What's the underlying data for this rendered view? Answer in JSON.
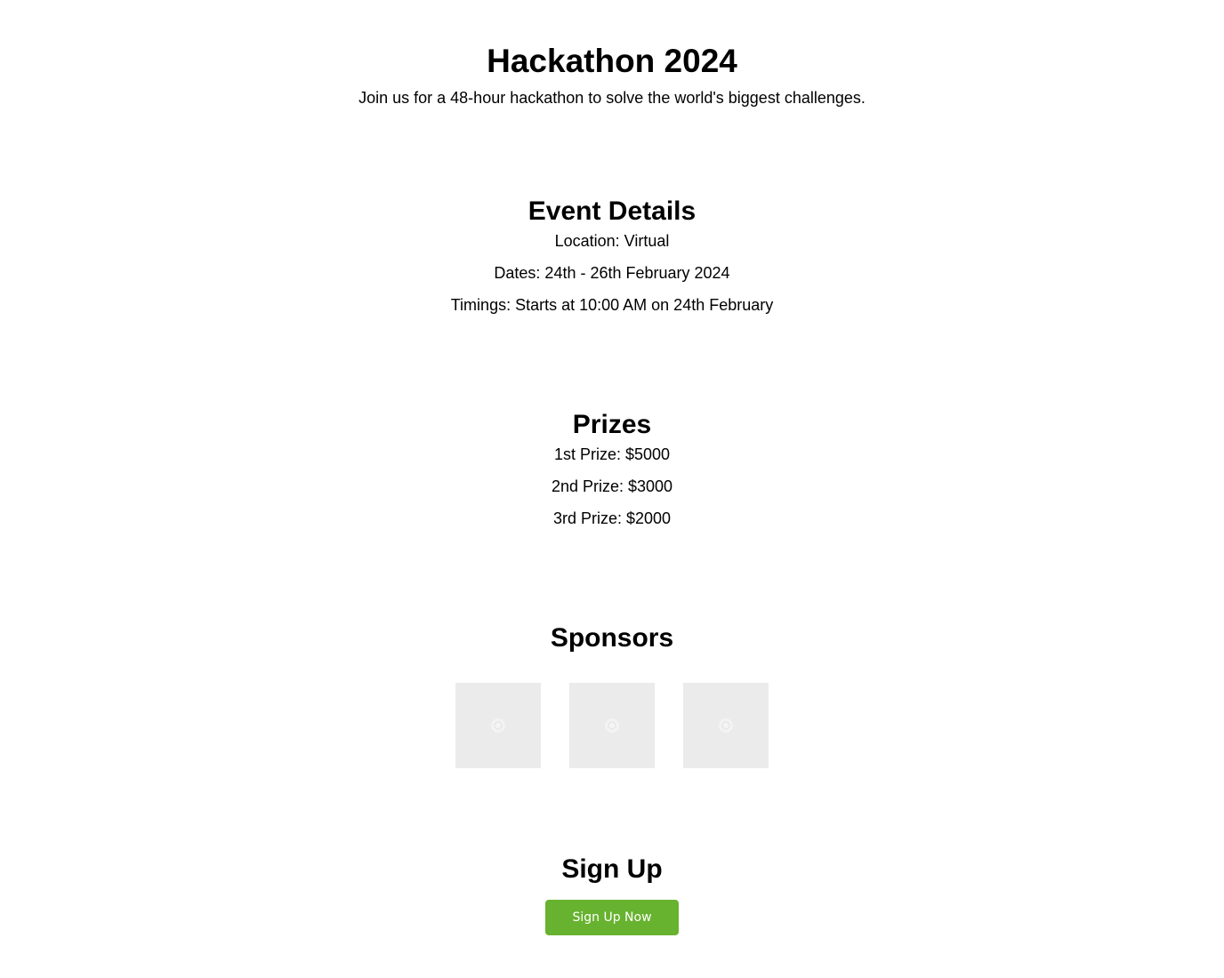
{
  "header": {
    "title": "Hackathon 2024",
    "subtitle": "Join us for a 48-hour hackathon to solve the world's biggest challenges."
  },
  "event_details": {
    "heading": "Event Details",
    "location": "Location: Virtual",
    "dates": "Dates: 24th - 26th February 2024",
    "timings": "Timings: Starts at 10:00 AM on 24th February"
  },
  "prizes": {
    "heading": "Prizes",
    "items": [
      "1st Prize: $5000",
      "2nd Prize: $3000",
      "3rd Prize: $2000"
    ]
  },
  "sponsors": {
    "heading": "Sponsors",
    "logos": [
      {
        "icon": "image-placeholder-icon"
      },
      {
        "icon": "image-placeholder-icon"
      },
      {
        "icon": "image-placeholder-icon"
      }
    ]
  },
  "signup": {
    "heading": "Sign Up",
    "button_label": "Sign Up Now"
  },
  "colors": {
    "button_background": "#67b22f",
    "button_text": "#ffffff",
    "placeholder_background": "#ebebeb"
  }
}
